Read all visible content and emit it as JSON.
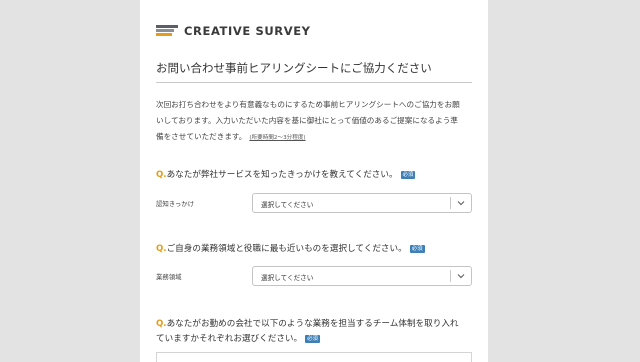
{
  "brand": {
    "name": "CREATIVE SURVEY",
    "colors": {
      "bar_dark": "#5c6066",
      "bar_mid": "#8a8f96",
      "bar_accent": "#e39d1a"
    }
  },
  "page": {
    "title": "お問い合わせ事前ヒアリングシートにご協力ください",
    "intro_line1": "次回お打ち合わせをより有意義なものにするため事前ヒアリングシートへのご協力をお願",
    "intro_line2": "いしております。入力いただいた内容を基に御社にとって価値のあるご提案になるよう準",
    "intro_line3": "備をさせていただきます。",
    "intro_note": "(所要時間2～3分程度)"
  },
  "questions": [
    {
      "prefix": "Q.",
      "text": "あなたが弊社サービスを知ったきっかけを教えてください。",
      "required_badge": "必須",
      "field_label": "認知きっかけ",
      "select_value": "選択してください"
    },
    {
      "prefix": "Q.",
      "text": "ご自身の業務領域と役職に最も近いものを選択してください。",
      "required_badge": "必須",
      "field_label": "業務領域",
      "select_value": "選択してください"
    },
    {
      "prefix": "Q.",
      "text_line1": "あなたがお勤めの会社で以下のような業務を担当するチーム体制を取り入れ",
      "text_line2": "ていますかそれぞれお選びください。",
      "required_badge": "必須"
    }
  ],
  "icons": {
    "select_arrow": "chevron-down-icon",
    "logo": "logo-mark-icon"
  }
}
